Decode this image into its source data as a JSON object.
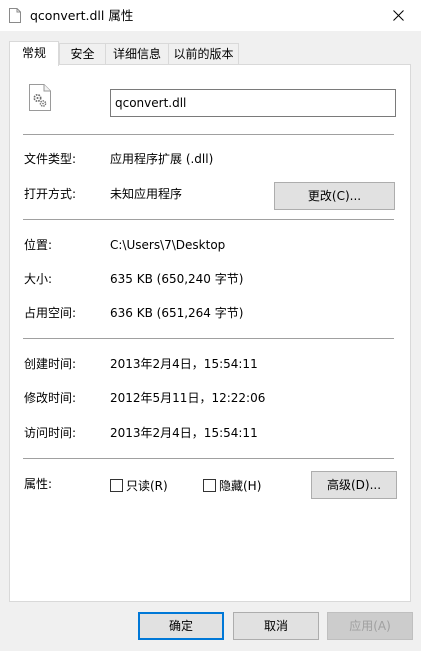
{
  "window": {
    "title": "qconvert.dll 属性"
  },
  "tabs": [
    {
      "label": "常规",
      "active": true
    },
    {
      "label": "安全"
    },
    {
      "label": "详细信息"
    },
    {
      "label": "以前的版本"
    }
  ],
  "file": {
    "name": "qconvert.dll"
  },
  "properties": {
    "type_label": "文件类型:",
    "type_value": "应用程序扩展 (.dll)",
    "opens_label": "打开方式:",
    "opens_value": "未知应用程序",
    "change_button": "更改(C)...",
    "location_label": "位置:",
    "location_value": "C:\\Users\\7\\Desktop",
    "size_label": "大小:",
    "size_value": "635 KB (650,240 字节)",
    "disk_label": "占用空间:",
    "disk_value": "636 KB (651,264 字节)",
    "created_label": "创建时间:",
    "created_value": "2013年2月4日，15:54:11",
    "modified_label": "修改时间:",
    "modified_value": "2012年5月11日，12:22:06",
    "accessed_label": "访问时间:",
    "accessed_value": "2013年2月4日，15:54:11",
    "attributes_label": "属性:",
    "readonly_label": "只读(R)",
    "hidden_label": "隐藏(H)",
    "advanced_button": "高级(D)..."
  },
  "footer": {
    "ok": "确定",
    "cancel": "取消",
    "apply": "应用(A)"
  }
}
